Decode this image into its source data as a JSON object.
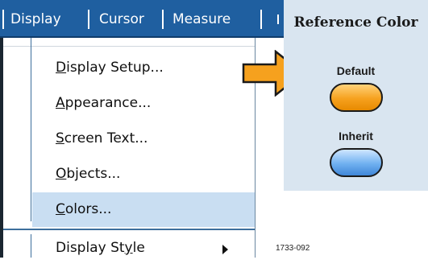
{
  "menubar": {
    "items": [
      "Display",
      "Cursor",
      "Measure"
    ]
  },
  "menu": {
    "items": [
      {
        "pre": "",
        "key": "D",
        "post": "isplay Setup..."
      },
      {
        "pre": "",
        "key": "A",
        "post": "ppearance..."
      },
      {
        "pre": "",
        "key": "S",
        "post": "creen Text..."
      },
      {
        "pre": "",
        "key": "O",
        "post": "bjects..."
      },
      {
        "pre": "",
        "key": "C",
        "post": "olors..."
      },
      {
        "pre": "Display St",
        "key": "y",
        "post": "le"
      }
    ]
  },
  "panel": {
    "title": "Reference Color",
    "default_label": "Default",
    "inherit_label": "Inherit"
  },
  "caption": "1733-092",
  "colors": {
    "menubar": "#1f5fa0",
    "selected": "#c9def2",
    "callout": "#f6a11e",
    "panel": "#d9e5f0"
  }
}
